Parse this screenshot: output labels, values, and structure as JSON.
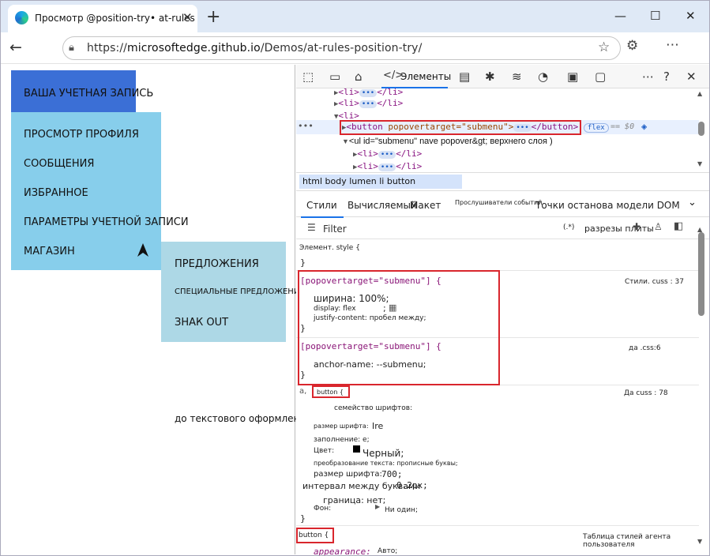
{
  "browser": {
    "tab_title": "Просмотр @position-try• at-rules",
    "tab_close": "✕",
    "new_tab": "+",
    "minimize": "—",
    "maximize": "☐",
    "close": "✕",
    "url_prefix": "https://",
    "url_host": "microsoftedge.github.io",
    "url_path": "/Demos/at-rules-position-try/"
  },
  "page": {
    "account": "ВАША УЧЕТНАЯ ЗАПИСЬ",
    "menu": [
      "ПРОСМОТР ПРОФИЛЯ",
      "СООБЩЕНИЯ",
      "ИЗБРАННОЕ",
      "ПАРАМЕТРЫ УЧЕТНОЙ ЗАПИСИ",
      "МАГАЗИН"
    ],
    "submenu": [
      "ПРЕДЛОЖЕНИЯ",
      "СПЕЦИАЛЬНЫЕ ПРЕДЛОЖЕНИЯ",
      "ЗНАК  OUT"
    ],
    "overlay_text": "до текстового оформления: нет;",
    "colors": {
      "account_bg": "#3b6fd6",
      "menu_bg": "#87ceeb",
      "submenu_bg": "#add8e6"
    }
  },
  "devtools": {
    "elements_tab": "Элементы",
    "dom": {
      "li1": "<li>",
      "li1_end": "</li>",
      "li2": "<li>",
      "li2_end": "</li>",
      "li_open": "<li>",
      "button_open": "<button",
      "button_attr": " popovertarget=\"submenu\">",
      "button_end": "</button>",
      "flex_badge": "flex",
      "eq_ref": "== $0",
      "ul_line": "<ul  id=\"submenu\" nave popover&gt; верхнего слоя )",
      "li3": "<li>",
      "li3_end": "</li>",
      "li4": "<li>",
      "li4_end": "</li>",
      "dots": "•••"
    },
    "breadcrumb": "html body lumen li button",
    "subtabs": {
      "styles": "Стили",
      "computed": "Вычисляемый",
      "layout": "Макет",
      "listeners": "Прослушиватели событий",
      "dom_breakpoints": "Точки останова модели DOM"
    },
    "filter": {
      "label": "Filter",
      "pseudo": "(.*)",
      "cls": "разрезы плиты"
    },
    "rules": {
      "element_style": "Элемент. style {",
      "close": "}",
      "r1_selector": "[popovertarget=\"submenu\"] {",
      "r1_source": "Стили. cuss : 37",
      "r1_width": "ширина: 100%;",
      "r1_display": "display: flex",
      "r1_display_end": ";",
      "r1_justify": "justify-content: пробел между;",
      "r2_selector": "[popovertarget=\"submenu\"] {",
      "r2_source": "да .css:6",
      "r2_anchor": "anchor-name: --submenu;",
      "r3_marker": "a,",
      "r3_selector": "button {",
      "r3_source": "Да cuss : 78",
      "r3_font_family": "семейство шрифтов:",
      "r3_font_size_label": "размер шрифта:",
      "r3_font_size_val": "Ire",
      "r3_padding": "заполнение: e;",
      "r3_color_label": "Цвет:",
      "r3_color_val": "Черный;",
      "r3_transform": "преобразование текста: прописные буквы;",
      "r3_weight_label": "размер шрифта:",
      "r3_weight_val": "700;",
      "r3_spacing_label": "интервал между буквами",
      "r3_spacing_val": "0.2px;",
      "r3_border": "граница: нет;",
      "r3_bg_label": "Фон:",
      "r3_bg_val": "Ни один;",
      "r4_selector": "button {",
      "r4_source": "Таблица стилей агента пользователя",
      "r4_appearance": "appearance:",
      "r4_appearance_val": "Авто;"
    }
  }
}
